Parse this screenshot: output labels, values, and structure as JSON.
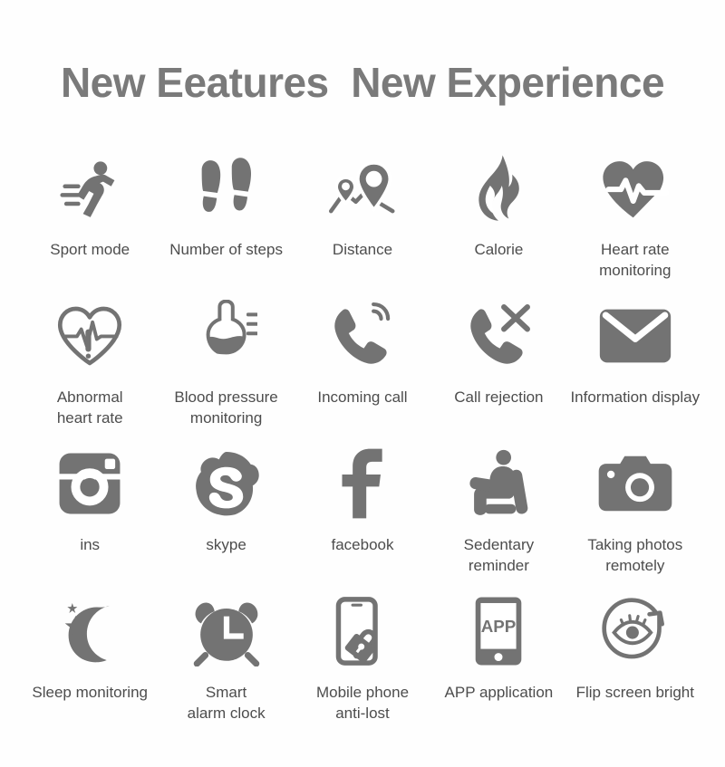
{
  "header": {
    "title": "New Eeatures  New Experience",
    "title_color": "#7a7a7a"
  },
  "theme": {
    "background": "#fefefe",
    "icon_color": "#737373",
    "label_color": "#4d4d4d"
  },
  "features": [
    {
      "icon": "running-person-icon",
      "label": "Sport mode"
    },
    {
      "icon": "footprints-icon",
      "label": "Number of steps"
    },
    {
      "icon": "map-pin-route-icon",
      "label": "Distance"
    },
    {
      "icon": "flame-icon",
      "label": "Calorie"
    },
    {
      "icon": "heart-pulse-filled-icon",
      "label": "Heart rate\nmonitoring"
    },
    {
      "icon": "heart-pulse-outline-alert-icon",
      "label": "Abnormal\nheart rate"
    },
    {
      "icon": "thermometer-icon",
      "label": "Blood pressure\nmonitoring"
    },
    {
      "icon": "phone-incoming-icon",
      "label": "Incoming call"
    },
    {
      "icon": "phone-reject-icon",
      "label": "Call rejection"
    },
    {
      "icon": "envelope-icon",
      "label": "Information display"
    },
    {
      "icon": "instagram-icon",
      "label": "ins"
    },
    {
      "icon": "skype-icon",
      "label": "skype"
    },
    {
      "icon": "facebook-icon",
      "label": "facebook"
    },
    {
      "icon": "sitting-person-icon",
      "label": "Sedentary\nreminder"
    },
    {
      "icon": "camera-icon",
      "label": "Taking photos\nremotely"
    },
    {
      "icon": "moon-stars-icon",
      "label": "Sleep monitoring"
    },
    {
      "icon": "alarm-clock-icon",
      "label": "Smart\nalarm clock"
    },
    {
      "icon": "phone-lock-icon",
      "label": "Mobile phone\nanti-lost"
    },
    {
      "icon": "app-phone-icon",
      "label": "APP application"
    },
    {
      "icon": "eye-rotate-icon",
      "label": "Flip screen bright"
    }
  ],
  "icon_text": {
    "app_label": "APP",
    "facebook_glyph": "f",
    "skype_glyph": "S"
  }
}
